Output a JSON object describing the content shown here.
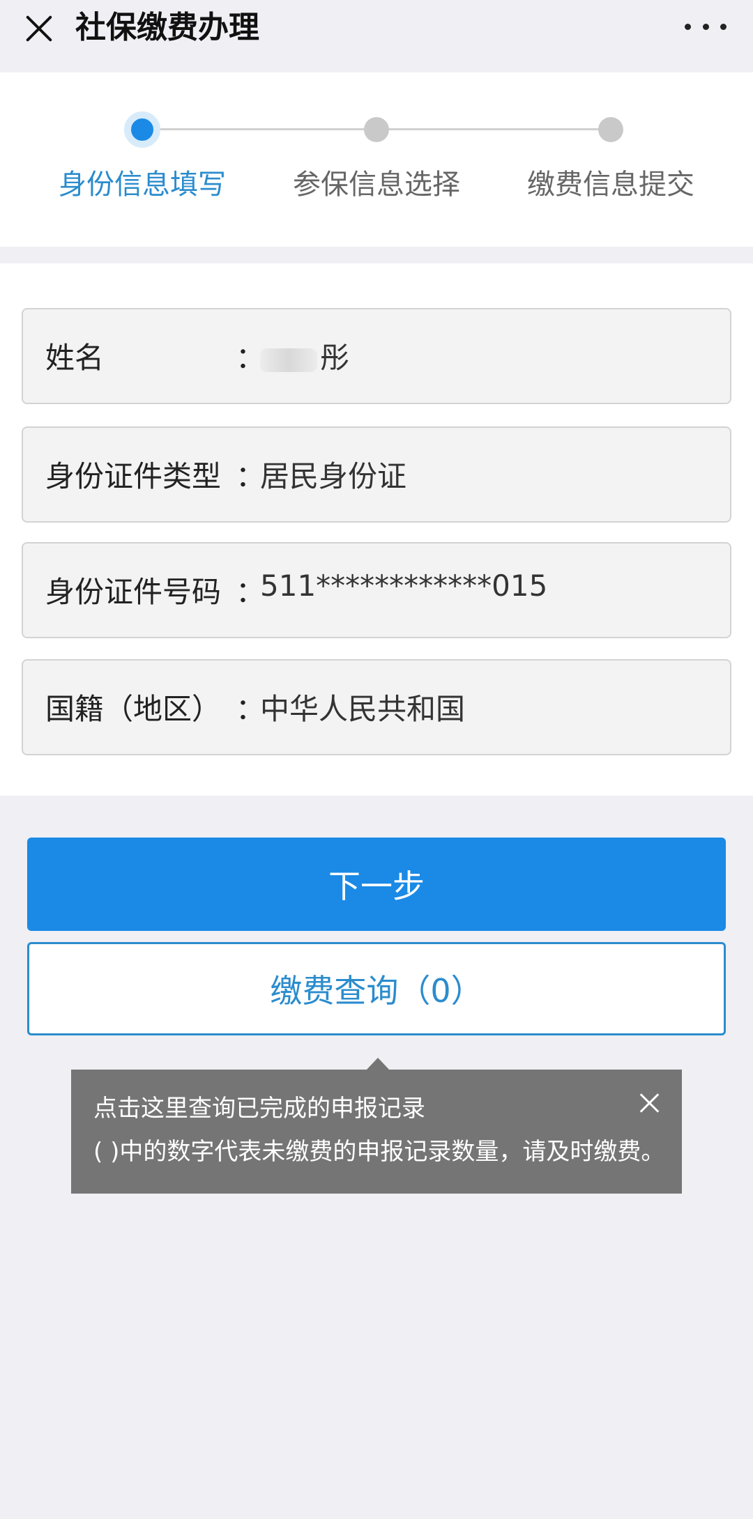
{
  "header": {
    "title": "社保缴费办理"
  },
  "steps": [
    {
      "label": "身份信息填写",
      "active": true
    },
    {
      "label": "参保信息选择",
      "active": false
    },
    {
      "label": "缴费信息提交",
      "active": false
    }
  ],
  "form": {
    "name": {
      "label": "姓名",
      "colon": "：",
      "value": "彤"
    },
    "id_type": {
      "label": "身份证件类型",
      "colon": "：",
      "value": "居民身份证"
    },
    "id_number": {
      "label": "身份证件号码",
      "colon": "：",
      "value": "511************015"
    },
    "nationality": {
      "label": "国籍（地区）",
      "colon": "：",
      "value": "中华人民共和国"
    }
  },
  "buttons": {
    "next": "下一步",
    "query": "缴费查询（0）"
  },
  "tooltip": {
    "line1": "点击这里查询已完成的申报记录",
    "line2": "( )中的数字代表未缴费的申报记录数量，请及时缴费。"
  },
  "colors": {
    "accent": "#1a8ae6",
    "accent_text": "#2b8ccd",
    "tooltip_bg": "#757575"
  }
}
